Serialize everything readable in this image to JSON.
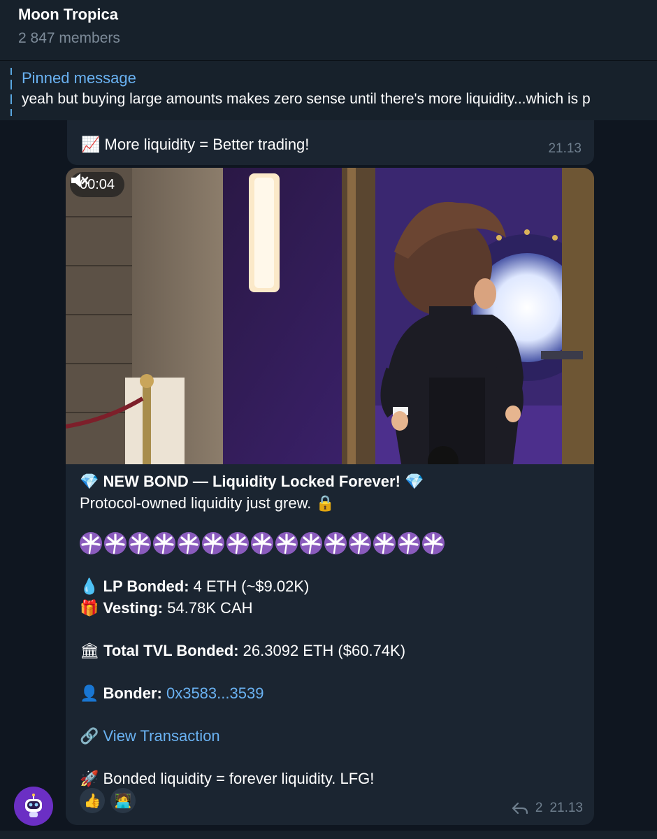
{
  "header": {
    "title": "Moon Tropica",
    "subtitle": "2 847 members"
  },
  "pinned": {
    "title": "Pinned message",
    "text": "yeah but buying large amounts makes zero sense until there's more liquidity...which is p"
  },
  "messages": {
    "top": {
      "icon": "chart-increasing-icon",
      "emoji": "📈",
      "text": "More liquidity = Better trading!",
      "time": "21.13"
    },
    "main": {
      "video": {
        "duration": "00:04",
        "muted_icon": "muted-speaker-icon"
      },
      "title_emoji_left": "💎",
      "title": "NEW BOND — Liquidity Locked Forever!",
      "title_emoji_right": "💎",
      "subtitle": "Protocol-owned liquidity just grew.",
      "subtitle_emoji": "🔒",
      "palm_count": 15,
      "lp": {
        "emoji": "💧",
        "label": "LP Bonded:",
        "value": " 4 ETH (~$9.02K)"
      },
      "vesting": {
        "emoji": "🎁",
        "label": "Vesting:",
        "value": " 54.78K CAH"
      },
      "tvl": {
        "emoji": "🏛",
        "label": "Total TVL Bonded:",
        "value": " 26.3092 ETH ($60.74K)"
      },
      "bonder": {
        "emoji": "👤",
        "label": "Bonder:",
        "value": " 0x3583...3539"
      },
      "transaction": {
        "emoji": "🔗",
        "label": "View Transaction"
      },
      "closing": {
        "emoji": "🚀",
        "text": "Bonded liquidity = forever liquidity. LFG!"
      },
      "reactions": [
        "👍",
        "🧑‍💻"
      ],
      "reply_count": "2",
      "time": "21.13"
    }
  },
  "colors": {
    "background": "#0f1620",
    "panel": "#17212b",
    "bubble": "#1b2531",
    "accent": "#6ab2f2",
    "muted": "#6f7f8e",
    "avatar": "#6b2fc4"
  }
}
